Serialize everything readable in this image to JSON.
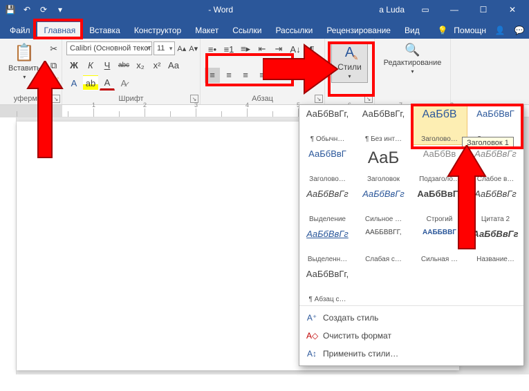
{
  "title": "- Word",
  "user": "a Luda",
  "qat": {
    "save": "💾",
    "undo": "↶",
    "redo": "↷",
    "repeat": "⟳"
  },
  "tabs": [
    "Файл",
    "Главная",
    "Вставка",
    "Конструктор",
    "Макет",
    "Ссылки",
    "Рассылки",
    "Рецензирование",
    "Вид",
    "Помощн"
  ],
  "active_tab": 1,
  "clipboard": {
    "paste": "Вставить",
    "label": "уферм     на"
  },
  "font": {
    "name": "Calibri (Основной текст",
    "size": "11",
    "label": "Шрифт",
    "bold": "Ж",
    "italic": "К",
    "underline": "Ч",
    "strike": "abc",
    "sub": "x₂",
    "sup": "x²",
    "case": "Aa",
    "clear": "A",
    "highlight": "ab",
    "color": "A"
  },
  "para": {
    "label": "Абзац"
  },
  "styles": {
    "label": "Стили"
  },
  "editing": {
    "label": "Редактирование"
  },
  "gallery": [
    {
      "preview": "АаБбВвГг,",
      "name": "¶ Обычн…",
      "cls": ""
    },
    {
      "preview": "АаБбВвГг,",
      "name": "¶ Без инт…",
      "cls": ""
    },
    {
      "preview": "АаБбВ",
      "name": "Заголово…",
      "cls": "blue big",
      "hovered": true
    },
    {
      "preview": "АаБбВвГ",
      "name": "Заголово…",
      "cls": "blue"
    },
    {
      "preview": "АаБбВвГ",
      "name": "Заголово…",
      "cls": "blue"
    },
    {
      "preview": "АаБ",
      "name": "Заголовок",
      "cls": "huge"
    },
    {
      "preview": "АаБбВв",
      "name": "Подзаголо…",
      "cls": "gray"
    },
    {
      "preview": "АаБбВвГг",
      "name": "Слабое в…",
      "cls": "gray italic"
    },
    {
      "preview": "АаБбВвГг",
      "name": "Выделение",
      "cls": "italic"
    },
    {
      "preview": "АаБбВвГг",
      "name": "Сильное …",
      "cls": "blue italic"
    },
    {
      "preview": "АаБбВвГг",
      "name": "Строгий",
      "cls": "bold"
    },
    {
      "preview": "АаБбВвГг",
      "name": "Цитата 2",
      "cls": "italic"
    },
    {
      "preview": "АаБбВвГг",
      "name": "Выделенн…",
      "cls": "blue italic underline"
    },
    {
      "preview": "ААББВВГГ,",
      "name": "Слабая с…",
      "cls": "small"
    },
    {
      "preview": "ААББВВГ",
      "name": "Сильная …",
      "cls": "blue bold small"
    },
    {
      "preview": "АаБбВвГг",
      "name": "Название…",
      "cls": "bold italic"
    },
    {
      "preview": "АаБбВвГг,",
      "name": "¶ Абзац с…",
      "cls": ""
    }
  ],
  "tooltip": "Заголовок 1",
  "footer": [
    {
      "icon": "А⁺",
      "label": "Создать стиль"
    },
    {
      "icon": "A◇",
      "label": "Очистить формат"
    },
    {
      "icon": "А↕",
      "label": "Применить стили…"
    }
  ],
  "colors": {
    "red": "#ff0000",
    "blue": "#2b579a"
  }
}
